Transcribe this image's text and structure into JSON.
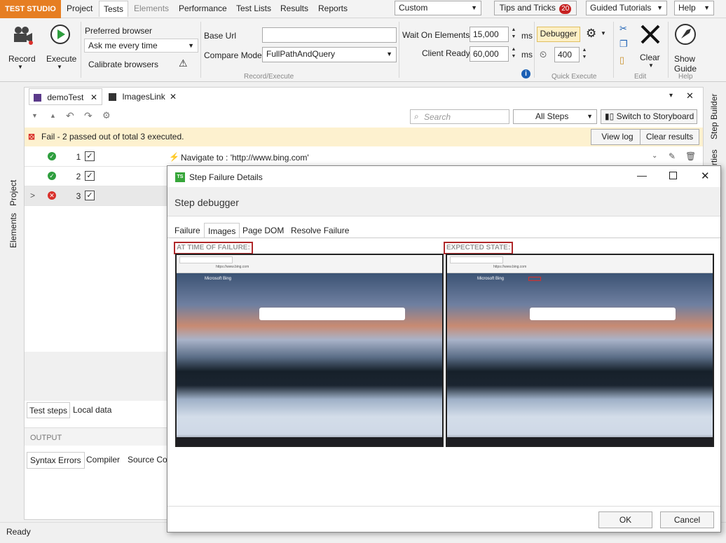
{
  "menubar": {
    "brand": "TEST STUDIO",
    "items": [
      "Project",
      "Tests",
      "Elements",
      "Performance",
      "Test Lists",
      "Results",
      "Reports"
    ],
    "layout_combo": "Custom",
    "tips_label": "Tips and Tricks",
    "tips_count": "20",
    "guided_label": "Guided Tutorials",
    "help_label": "Help"
  },
  "ribbon": {
    "record_label": "Record",
    "execute_label": "Execute",
    "preferred_browser_label": "Preferred browser",
    "preferred_browser_value": "Ask me every time",
    "calibrate_label": "Calibrate browsers",
    "base_url_label": "Base Url",
    "base_url_value": "",
    "compare_mode_label": "Compare Mode",
    "compare_mode_value": "FullPathAndQuery",
    "wait_label": "Wait On Elements",
    "wait_value": "15,000",
    "client_ready_label": "Client Ready",
    "client_ready_value": "60,000",
    "ms_label": "ms",
    "debugger_label": "Debugger",
    "delay_value": "400",
    "clear_label": "Clear",
    "show_guide_label_1": "Show",
    "show_guide_label_2": "Guide",
    "group_record_execute": "Record/Execute",
    "group_quick_execute": "Quick Execute",
    "group_edit": "Edit",
    "group_help": "Help"
  },
  "left_rail": {
    "project": "Project",
    "elements": "Elements"
  },
  "right_rail": {
    "step_builder": "Step Builder",
    "properties": "rties"
  },
  "doc_tabs": [
    {
      "label": "demoTest"
    },
    {
      "label": "ImagesLink"
    }
  ],
  "steps_toolbar": {
    "search_placeholder": "Search",
    "steps_filter": "All Steps",
    "storyboard_label": "Switch to Storyboard"
  },
  "failbar": {
    "message": "Fail - 2 passed out of total 3 executed.",
    "view_log": "View log",
    "clear_results": "Clear results"
  },
  "step_rows": [
    {
      "num": "1",
      "status": "pass"
    },
    {
      "num": "2",
      "status": "pass"
    },
    {
      "num": "3",
      "status": "fail"
    }
  ],
  "step1_text": "Navigate to : 'http://www.bing.com'",
  "bottom_tabs": {
    "test_steps": "Test steps",
    "local_data": "Local data"
  },
  "output": {
    "title": "OUTPUT",
    "tabs": [
      "Syntax Errors",
      "Compiler",
      "Source Con"
    ]
  },
  "status_bar": {
    "ready": "Ready"
  },
  "dialog": {
    "title": "Step Failure Details",
    "heading": "Step debugger",
    "tabs": [
      "Failure",
      "Images",
      "Page DOM",
      "Resolve Failure"
    ],
    "active_tab": "Images",
    "left_caption": "AT TIME OF FAILURE:",
    "right_caption": "EXPECTED STATE:",
    "ok_label": "OK",
    "cancel_label": "Cancel",
    "shot_url": "https://www.bing.com",
    "shot_brand": "Microsoft Bing"
  },
  "colors": {
    "brand_orange": "#e67e22",
    "fail_bar": "#fdf1cf",
    "pass_green": "#2e9e3e",
    "fail_red": "#d9302b",
    "highlight_red": "#b0282a"
  }
}
